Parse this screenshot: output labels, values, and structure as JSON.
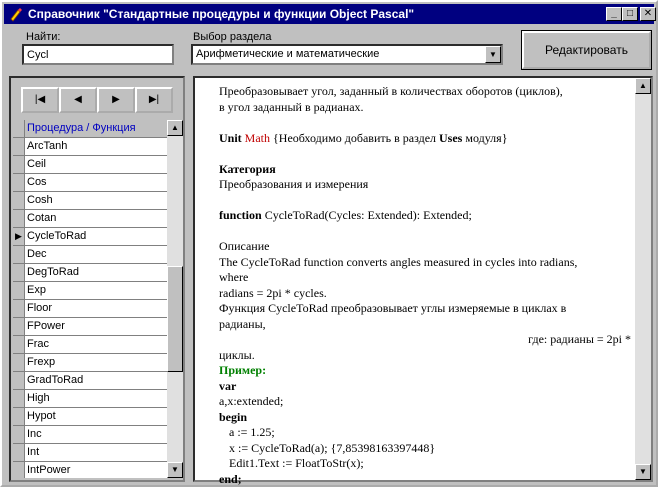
{
  "window": {
    "title": "Справочник \"Стандартные процедуры и функции Object Pascal\"",
    "min_glyph": "_",
    "max_glyph": "□",
    "close_glyph": "✕"
  },
  "search": {
    "label": "Найти:",
    "value": "Cycl"
  },
  "section": {
    "label": "Выбор раздела",
    "selected": "Арифметические и математические"
  },
  "edit_button": "Редактировать",
  "nav": {
    "first": "|◀",
    "prev": "◀",
    "next": "▶",
    "last": "▶|"
  },
  "grid": {
    "header": "Процедура / Функция",
    "current_indicator": "▶",
    "rows": [
      "ArcTanh",
      "Ceil",
      "Cos",
      "Cosh",
      "Cotan",
      "CycleToRad",
      "Dec",
      "DegToRad",
      "Exp",
      "Floor",
      "FPower",
      "Frac",
      "Frexp",
      "GradToRad",
      "High",
      "Hypot",
      "Inc",
      "Int",
      "IntPower"
    ],
    "selected_index": 5
  },
  "scroll_glyphs": {
    "up": "▲",
    "down": "▼"
  },
  "doc": {
    "intro1": "Преобразовывает угол, заданный в количествах оборотов (циклов),",
    "intro2": "в угол заданный в радианах.",
    "unit_kw": "Unit",
    "unit_name": "Math",
    "unit_note_a": " {Необходимо добавить в раздел ",
    "unit_note_uses": "Uses",
    "unit_note_b": " модуля}",
    "cat_title": "Категория",
    "cat_value": "Преобразования и измерения",
    "func_kw": "function",
    "func_sig": " CycleToRad(Cycles: Extended): Extended;",
    "desc_title": "Описание",
    "desc_en1": "The CycleToRad function converts angles measured in cycles into radians,",
    "desc_en2": "where",
    "desc_en3": "radians = 2pi * cycles.",
    "desc_ru1": "Функция CycleToRad  преобразовывает углы измеряемые в циклах в",
    "desc_ru2": "радианы,",
    "desc_ru3": "где: радианы = 2pi *",
    "desc_ru4": "циклы.",
    "example_title": "Пример:",
    "code_var": "var",
    "code_decl": "a,x:extended;",
    "code_begin": "begin",
    "code_1": "a := 1.25;",
    "code_2": "x := CycleToRad(a);  {7,85398163397448}",
    "code_3": "Edit1.Text := FloatToStr(x);",
    "code_end": "end;"
  }
}
